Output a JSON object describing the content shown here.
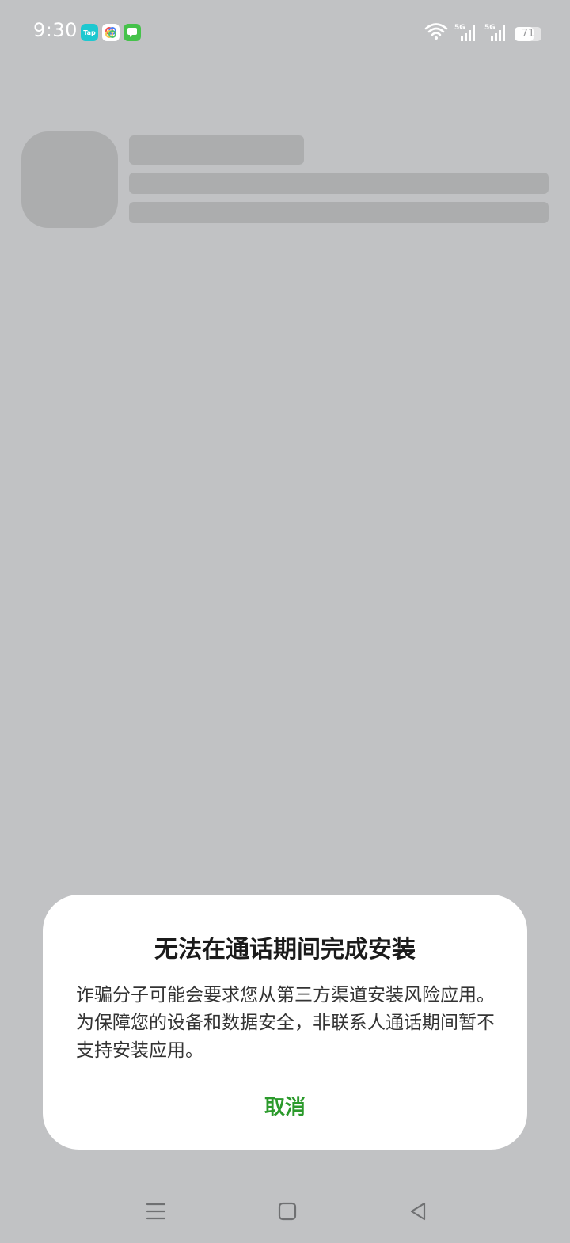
{
  "status_bar": {
    "time": "9:30",
    "notifications": [
      {
        "name": "tap-app-icon",
        "label": "Tap"
      },
      {
        "name": "photos-app-icon"
      },
      {
        "name": "messages-app-icon"
      }
    ],
    "signal_1_label": "5G",
    "signal_2_label": "5G",
    "battery": "71",
    "battery_level": 0.71
  },
  "dialog": {
    "title": "无法在通话期间完成安装",
    "body": "诈骗分子可能会要求您从第三方渠道安装风险应用。为保障您的设备和数据安全，非联系人通话期间暂不支持安装应用。",
    "cancel_label": "取消"
  },
  "colors": {
    "background": "#c1c2c4",
    "skeleton": "#acadae",
    "dialog_bg": "#ffffff",
    "accent": "#2b9a2b"
  },
  "icons": {
    "nav_menu": "menu-icon",
    "nav_home": "home-icon",
    "nav_back": "back-icon",
    "wifi": "wifi-icon",
    "signal": "signal-icon",
    "battery": "battery-icon"
  }
}
